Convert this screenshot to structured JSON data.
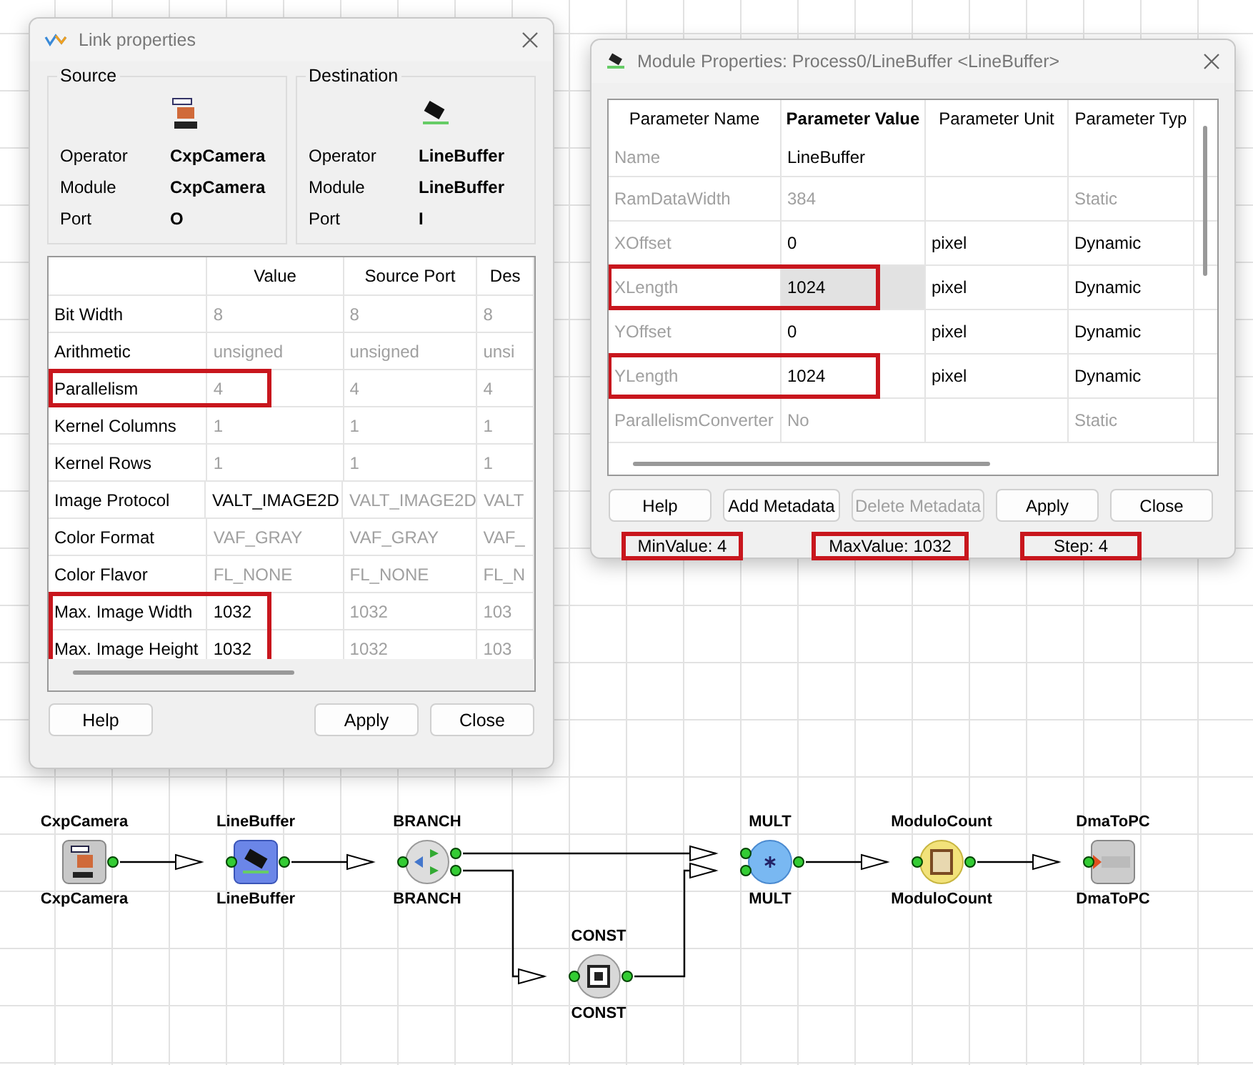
{
  "link_dialog": {
    "title": "Link properties",
    "source": {
      "heading": "Source",
      "fields": [
        {
          "label": "Operator",
          "value": "CxpCamera"
        },
        {
          "label": "Module",
          "value": "CxpCamera"
        },
        {
          "label": "Port",
          "value": "O"
        }
      ]
    },
    "destination": {
      "heading": "Destination",
      "fields": [
        {
          "label": "Operator",
          "value": "LineBuffer"
        },
        {
          "label": "Module",
          "value": "LineBuffer"
        },
        {
          "label": "Port",
          "value": "I"
        }
      ]
    },
    "table": {
      "columns": [
        "Value",
        "Source Port",
        "Des"
      ],
      "rows": [
        {
          "name": "Bit Width",
          "editable": false,
          "highlighted": false,
          "cells": [
            "8",
            "8",
            "8"
          ]
        },
        {
          "name": "Arithmetic",
          "editable": false,
          "highlighted": false,
          "cells": [
            "unsigned",
            "unsigned",
            "unsi"
          ]
        },
        {
          "name": "Parallelism",
          "editable": false,
          "highlighted": true,
          "cells": [
            "4",
            "4",
            "4"
          ]
        },
        {
          "name": "Kernel Columns",
          "editable": false,
          "highlighted": false,
          "cells": [
            "1",
            "1",
            "1"
          ]
        },
        {
          "name": "Kernel Rows",
          "editable": false,
          "highlighted": false,
          "cells": [
            "1",
            "1",
            "1"
          ]
        },
        {
          "name": "Image Protocol",
          "editable": true,
          "highlighted": false,
          "cells": [
            "VALT_IMAGE2D",
            "VALT_IMAGE2D",
            "VALT"
          ]
        },
        {
          "name": "Color Format",
          "editable": false,
          "highlighted": false,
          "cells": [
            "VAF_GRAY",
            "VAF_GRAY",
            "VAF_"
          ]
        },
        {
          "name": "Color Flavor",
          "editable": false,
          "highlighted": false,
          "cells": [
            "FL_NONE",
            "FL_NONE",
            "FL_N"
          ]
        },
        {
          "name": "Max. Image Width",
          "editable": true,
          "highlighted": true,
          "cells": [
            "1032",
            "1032",
            "103"
          ]
        },
        {
          "name": "Max. Image Height",
          "editable": true,
          "highlighted": true,
          "cells": [
            "1032",
            "1032",
            "103"
          ]
        }
      ]
    },
    "buttons": [
      {
        "label": "Help",
        "disabled": false
      },
      {
        "label": "Apply",
        "disabled": false
      },
      {
        "label": "Close",
        "disabled": false
      }
    ]
  },
  "module_dialog": {
    "title": "Module Properties: Process0/LineBuffer <LineBuffer>",
    "table": {
      "columns": [
        "Parameter Name",
        "Parameter Value",
        "Parameter Unit",
        "Parameter Typ"
      ],
      "rows": [
        {
          "name": "Name",
          "value": "LineBuffer",
          "unit": "",
          "type": "",
          "editable": true,
          "selected": false,
          "highlighted": false
        },
        {
          "name": "RamDataWidth",
          "value": "384",
          "unit": "",
          "type": "Static",
          "editable": false,
          "selected": false,
          "highlighted": false
        },
        {
          "name": "XOffset",
          "value": "0",
          "unit": "pixel",
          "type": "Dynamic",
          "editable": true,
          "selected": false,
          "highlighted": false
        },
        {
          "name": "XLength",
          "value": "1024",
          "unit": "pixel",
          "type": "Dynamic",
          "editable": true,
          "selected": true,
          "highlighted": true
        },
        {
          "name": "YOffset",
          "value": "0",
          "unit": "pixel",
          "type": "Dynamic",
          "editable": true,
          "selected": false,
          "highlighted": false
        },
        {
          "name": "YLength",
          "value": "1024",
          "unit": "pixel",
          "type": "Dynamic",
          "editable": true,
          "selected": false,
          "highlighted": true
        },
        {
          "name": "ParallelismConverter",
          "value": "No",
          "unit": "",
          "type": "Static",
          "editable": false,
          "selected": false,
          "highlighted": false
        }
      ]
    },
    "buttons": [
      {
        "label": "Help",
        "disabled": false
      },
      {
        "label": "Add Metadata",
        "disabled": false
      },
      {
        "label": "Delete Metadata",
        "disabled": true
      },
      {
        "label": "Apply",
        "disabled": false
      },
      {
        "label": "Close",
        "disabled": false
      }
    ],
    "status_bar": [
      {
        "text": "MinValue: 4",
        "highlighted": true
      },
      {
        "text": "MaxValue: 1032",
        "highlighted": true
      },
      {
        "text": "Step: 4",
        "highlighted": true
      }
    ]
  },
  "diagram": {
    "nodes": [
      {
        "kind": "camera",
        "label_top": "CxpCamera",
        "label_bottom": "CxpCamera"
      },
      {
        "kind": "buffer",
        "label_top": "LineBuffer",
        "label_bottom": "LineBuffer"
      },
      {
        "kind": "branch",
        "label_top": "BRANCH",
        "label_bottom": "BRANCH"
      },
      {
        "kind": "mult",
        "label_top": "MULT",
        "label_bottom": "MULT"
      },
      {
        "kind": "counter",
        "label_top": "ModuloCount",
        "label_bottom": "ModuloCount"
      },
      {
        "kind": "dma",
        "label_top": "DmaToPC",
        "label_bottom": "DmaToPC"
      },
      {
        "kind": "const",
        "label_top": "CONST",
        "label_bottom": "CONST"
      }
    ]
  }
}
